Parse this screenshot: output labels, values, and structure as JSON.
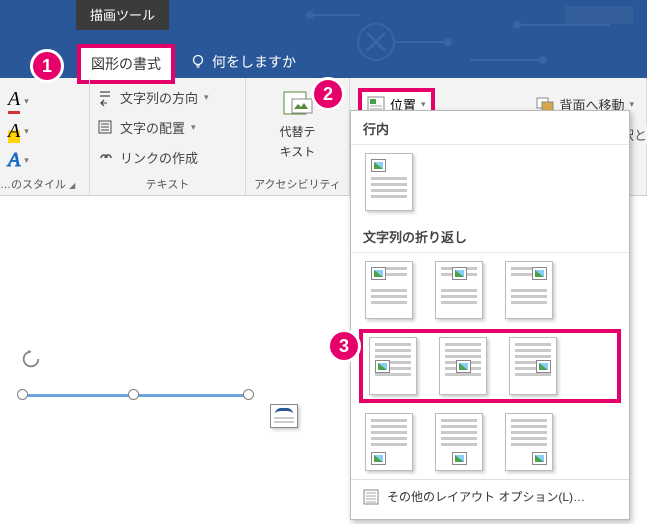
{
  "badges": {
    "one": "1",
    "two": "2",
    "three": "3"
  },
  "header": {
    "context_tab": "描画ツール",
    "active_tab": "図形の書式",
    "help_prompt": "何をしますか"
  },
  "ribbon": {
    "wordart_group": "…のスタイル",
    "text_group": "テキスト",
    "accessibility_group": "アクセシビリティ",
    "text_direction": "文字列の方向",
    "text_alignment": "文字の配置",
    "create_link": "リンクの作成",
    "alt_text_line1": "代替テ",
    "alt_text_line2": "キスト",
    "position": "位置",
    "send_back": "背面へ移動",
    "truncated": "選択と"
  },
  "dropdown": {
    "inline_header": "行内",
    "wrap_header": "文字列の折り返し",
    "more_options": "その他のレイアウト オプション(L)…"
  }
}
